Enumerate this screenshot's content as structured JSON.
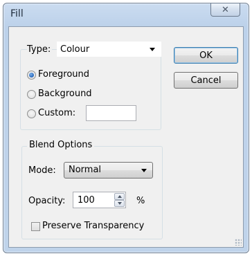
{
  "window": {
    "title": "Fill",
    "close_glyph": "✕"
  },
  "fill_group": {
    "type_label": "Type:",
    "type_value": "Colour",
    "radios": [
      {
        "label": "Foreground",
        "selected": true
      },
      {
        "label": "Background",
        "selected": false
      },
      {
        "label": "Custom:",
        "selected": false
      }
    ],
    "custom_value": ""
  },
  "buttons": {
    "ok": "OK",
    "cancel": "Cancel"
  },
  "blend": {
    "legend": "Blend Options",
    "mode_label": "Mode:",
    "mode_value": "Normal",
    "opacity_label": "Opacity:",
    "opacity_value": "100",
    "opacity_unit": "%",
    "preserve_label": "Preserve Transparency",
    "preserve_checked": false
  },
  "icons": {
    "close": "close-icon",
    "dropdown": "chevron-down-icon",
    "spin_up": "spin-up-icon",
    "spin_down": "spin-down-icon"
  },
  "colors": {
    "title_bar": "#bfd3ea",
    "client": "#f0f0f0",
    "radio_selected": "#2f6fc2",
    "default_button_border": "#3c7fb1"
  }
}
